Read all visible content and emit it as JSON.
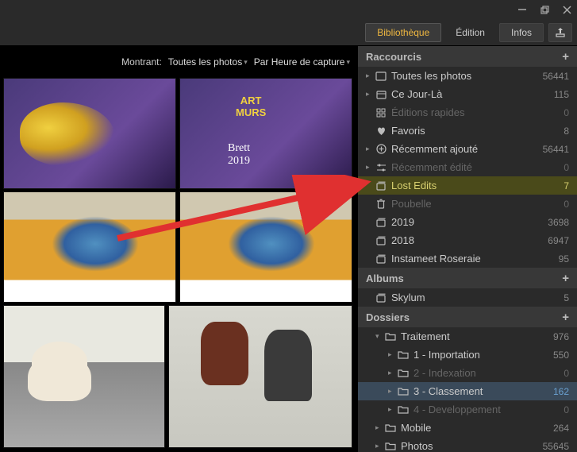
{
  "window": {
    "minimize": "–",
    "maximize": "❐",
    "close": "✕"
  },
  "tabs": {
    "library": "Bibliothèque",
    "edit": "Édition",
    "info": "Infos"
  },
  "filter": {
    "showing_label": "Montrant:",
    "all_photos": "Toutes les photos",
    "sort_by": "Par Heure de capture"
  },
  "sections": {
    "shortcuts": "Raccourcis",
    "albums": "Albums",
    "folders": "Dossiers"
  },
  "shortcuts": [
    {
      "label": "Toutes les photos",
      "count": "56441",
      "icon": "photos",
      "expandable": true
    },
    {
      "label": "Ce Jour-Là",
      "count": "115",
      "icon": "calendar",
      "expandable": true
    },
    {
      "label": "Éditions rapides",
      "count": "0",
      "icon": "grid",
      "dim": true
    },
    {
      "label": "Favoris",
      "count": "8",
      "icon": "heart"
    },
    {
      "label": "Récemment ajouté",
      "count": "56441",
      "icon": "plus-circle",
      "expandable": true
    },
    {
      "label": "Récemment édité",
      "count": "0",
      "icon": "sliders",
      "dim": true,
      "expandable": true
    },
    {
      "label": "Lost Edits",
      "count": "7",
      "icon": "stack",
      "hl": true
    },
    {
      "label": "Poubelle",
      "count": "0",
      "icon": "trash",
      "dim": true
    },
    {
      "label": "2019",
      "count": "3698",
      "icon": "stack"
    },
    {
      "label": "2018",
      "count": "6947",
      "icon": "stack"
    },
    {
      "label": "Instameet Roseraie",
      "count": "95",
      "icon": "stack"
    }
  ],
  "albums": [
    {
      "label": "Skylum",
      "count": "5",
      "icon": "stack"
    }
  ],
  "folders": [
    {
      "label": "Traitement",
      "count": "976",
      "expanded": true,
      "children": [
        {
          "label": "1 - Importation",
          "count": "550",
          "expandable": true
        },
        {
          "label": "2 - Indexation",
          "count": "0",
          "dim": true,
          "expandable": true
        },
        {
          "label": "3 - Classement",
          "count": "162",
          "sel": true,
          "expandable": true
        },
        {
          "label": "4 - Developpement",
          "count": "0",
          "dim": true,
          "expandable": true
        }
      ]
    },
    {
      "label": "Mobile",
      "count": "264",
      "expandable": true
    },
    {
      "label": "Photos",
      "count": "55645",
      "expandable": true
    }
  ]
}
